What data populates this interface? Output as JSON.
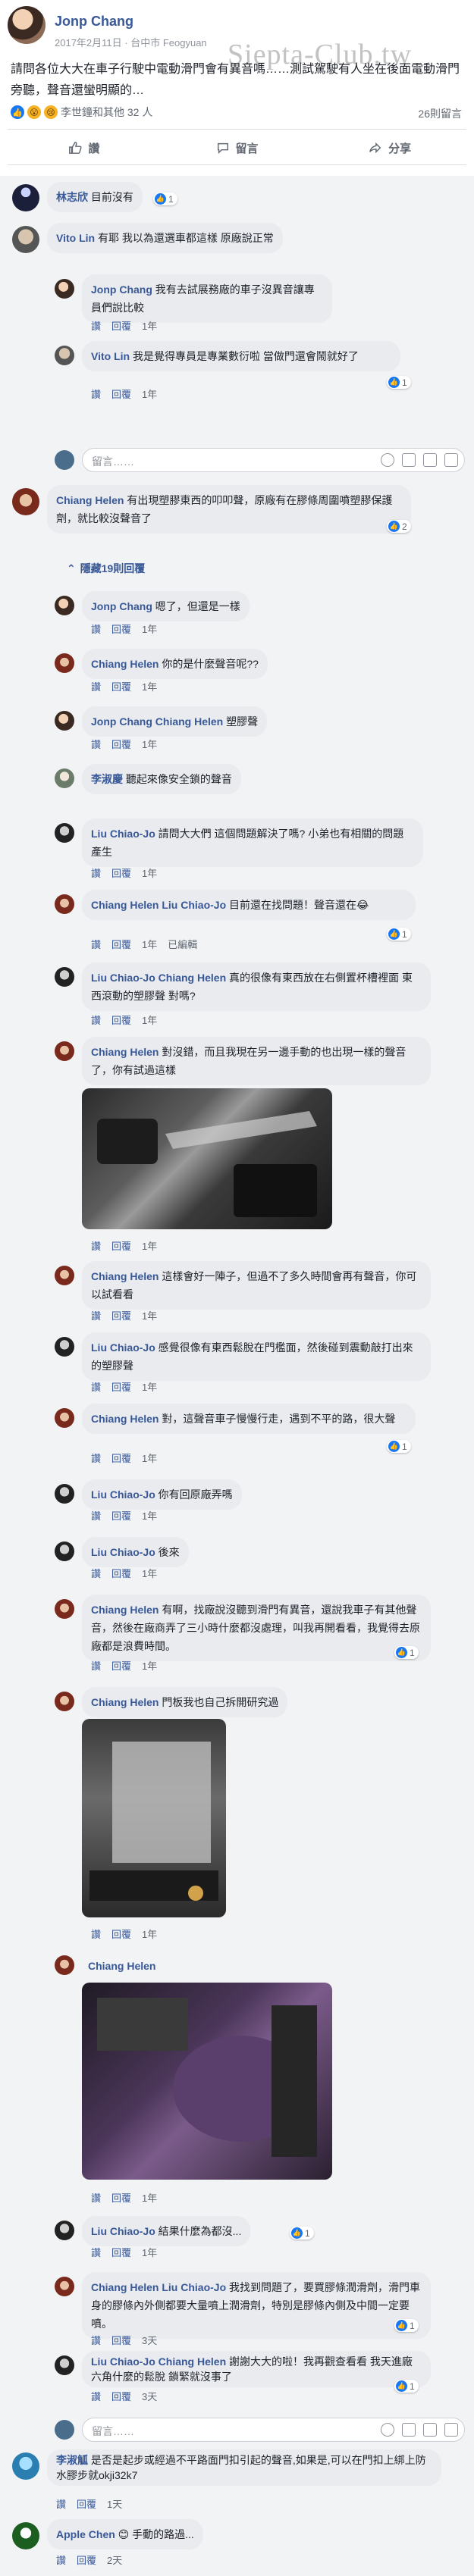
{
  "post": {
    "author": "Jonp Chang",
    "date": "2017年2月11日",
    "location": "台中市 Feogyuan",
    "text": "請問各位大大在車子行駛中電動滑門會有異音嗎……測試駕駛有人坐在後面電動滑門旁聽，聲音還蠻明顯的…",
    "watermark": "Siepta-Club.tw",
    "reactions_text": "李世鐘和其他 32 人",
    "comments_count": "26則留言",
    "actions": {
      "like": "讚",
      "comment": "留言",
      "share": "分享"
    }
  },
  "reply_placeholder": "留言……",
  "hidden_replies": "隱藏19則回覆",
  "comments": [
    {
      "name": "林志欣",
      "text": "目前沒有",
      "likes": "1",
      "time": ""
    },
    {
      "name": "Vito Lin",
      "text": "有耶 我以為還選車都這樣 原廠說正常",
      "likes": "",
      "time": ""
    },
    {
      "name": "Jonp Chang",
      "text": "我有去試展務廠的車子沒異音讓專員們說比較",
      "likes": "",
      "time": "1年"
    },
    {
      "name": "Vito Lin",
      "text": "我是覺得專員是專業數衍啦 當做門還會鬧就好了",
      "likes": "1",
      "time": "1年"
    },
    {
      "name": "Chiang Helen",
      "text": "有出現塑膠東西的叩叩聲，原廠有在膠條周圍噴塑膠保護劑，就比較沒聲音了",
      "likes": "2",
      "time": ""
    },
    {
      "name": "Jonp Chang",
      "text": "嗯了，但還是一樣",
      "likes": "",
      "time": "1年"
    },
    {
      "name": "Chiang Helen",
      "text": "你的是什麼聲音呢??",
      "likes": "",
      "time": "1年"
    },
    {
      "name": "Jonp Chang",
      "mention": "Chiang Helen",
      "text": "塑膠聲",
      "likes": "",
      "time": "1年"
    },
    {
      "name": "李淑慶",
      "text": "聽起來像安全鎖的聲音",
      "likes": "",
      "time": ""
    },
    {
      "name": "Liu Chiao-Jo",
      "text": "請問大大們 這個問題解決了嗎? 小弟也有相關的問題產生",
      "likes": "",
      "time": "1年"
    },
    {
      "name": "Chiang Helen",
      "mention": "Liu Chiao-Jo",
      "text": "目前還在找問題！聲音還在😂",
      "likes": "1",
      "time": "1年",
      "edited": "已編輯"
    },
    {
      "name": "Liu Chiao-Jo",
      "mention": "Chiang Helen",
      "text": "真的很像有東西放在右側置杯槽裡面 東西滾動的塑膠聲 對嗎?",
      "likes": "",
      "time": "1年"
    },
    {
      "name": "Chiang Helen",
      "text": "對沒錯，而且我現在另一邊手動的也出現一樣的聲音了，你有試過這樣",
      "likes": "",
      "time": "1年"
    },
    {
      "name": "Chiang Helen",
      "text": "這樣會好一陣子，但過不了多久時間會再有聲音，你可以試看看",
      "likes": "",
      "time": "1年"
    },
    {
      "name": "Liu Chiao-Jo",
      "text": "感覺很像有東西鬆脫在門檻面，然後碰到震動敲打出來的塑膠聲",
      "likes": "",
      "time": "1年"
    },
    {
      "name": "Chiang Helen",
      "text": "對，這聲音車子慢慢行走，遇到不平的路，很大聲",
      "likes": "1",
      "time": "1年"
    },
    {
      "name": "Liu Chiao-Jo",
      "text": "你有回原廠弄嗎",
      "likes": "",
      "time": "1年"
    },
    {
      "name": "Liu Chiao-Jo",
      "text": "後來",
      "likes": "",
      "time": "1年"
    },
    {
      "name": "Chiang Helen",
      "text": "有啊，找廠說沒聽到滑門有異音，還說我車子有其他聲音，然後在廠商弄了三小時什麼都沒處理，叫我再開看看，我覺得去原廠都是浪費時間。",
      "likes": "1",
      "time": "1年"
    },
    {
      "name": "Chiang Helen",
      "text": "門板我也自己拆開研究過",
      "likes": "",
      "time": "1年"
    },
    {
      "name": "Chiang Helen",
      "text": "",
      "likes": "",
      "time": "1年"
    },
    {
      "name": "Liu Chiao-Jo",
      "text": "結果什麼為都沒...",
      "likes": "1",
      "time": "1年"
    },
    {
      "name": "Chiang Helen",
      "mention": "Liu Chiao-Jo",
      "text": "我找到問題了，要買膠條潤滑劑，滑門車身的膠條內外側都要大量噴上潤滑劑，特別是膠條內側及中間一定要噴。",
      "likes": "1",
      "time": "3天"
    },
    {
      "name": "Liu Chiao-Jo",
      "mention": "Chiang Helen",
      "text": "謝謝大大的啦！我再觀查看看 我天進廠 六角什麼的鬆脫 鎖緊就沒事了",
      "likes": "1",
      "time": "3天"
    },
    {
      "name": "李淑觚",
      "text": "是否是起步或經過不平路面門扣引起的聲音,如果是,可以在門扣上綁上防水膠步就okji32k7",
      "likes": "",
      "time": "1天"
    },
    {
      "name": "Apple Chen",
      "text": "😊 手動的路過...",
      "likes": "",
      "time": "2天"
    }
  ],
  "meta_actions": {
    "like": "讚",
    "reply": "回覆"
  }
}
